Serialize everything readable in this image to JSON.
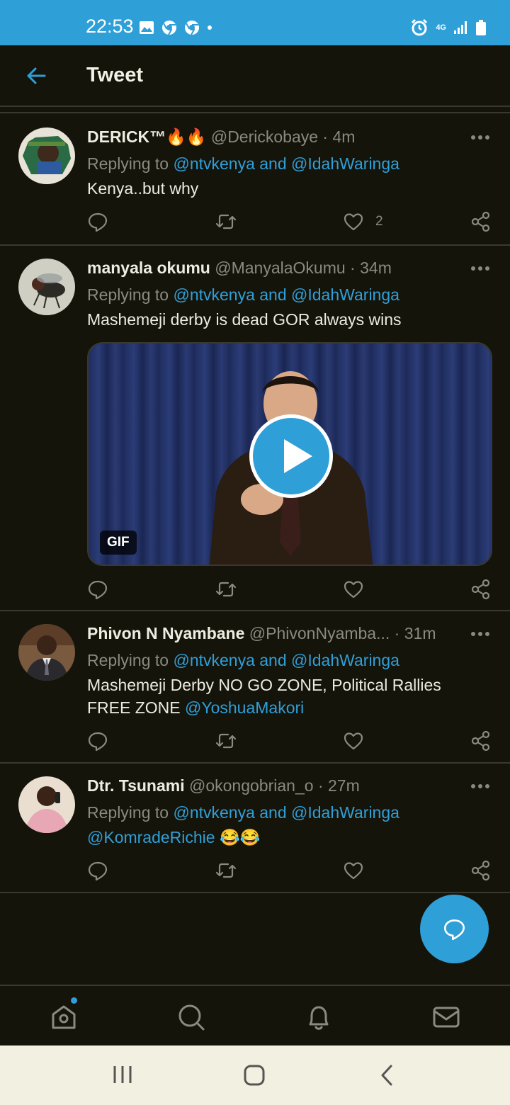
{
  "status": {
    "time": "22:53",
    "network": "4G"
  },
  "header": {
    "title": "Tweet"
  },
  "tweets": [
    {
      "name": "DERICK™🔥🔥",
      "handle": "@Derickobaye",
      "time": "4m",
      "replying_prefix": "Replying to",
      "replying_targets": "@ntvkenya and @IdahWaringa",
      "text": "Kenya..but why",
      "likes": "2"
    },
    {
      "name": "manyala okumu",
      "handle": "@ManyalaOkumu",
      "time": "34m",
      "replying_prefix": "Replying to",
      "replying_targets": "@ntvkenya and @IdahWaringa",
      "text": "Mashemeji derby is dead GOR always wins",
      "media_badge": "GIF"
    },
    {
      "name": "Phivon N Nyambane",
      "handle": "@PhivonNyamba...",
      "time": "31m",
      "replying_prefix": "Replying to",
      "replying_targets": "@ntvkenya and @IdahWaringa",
      "text_line1": "Mashemeji Derby NO GO ZONE, Political Rallies",
      "text_line2": "FREE ZONE",
      "text_mention": "@YoshuaMakori"
    },
    {
      "name": "Dtr. Tsunami",
      "handle": "@okongobrian_o",
      "time": "27m",
      "replying_prefix": "Replying to",
      "replying_targets": "@ntvkenya and @IdahWaringa",
      "text_mention": "@KomradeRichie",
      "text": "😂😂"
    }
  ],
  "colors": {
    "accent": "#2f9fd8",
    "background": "#15140a",
    "muted": "#8b8a80"
  },
  "icons": {
    "nav": [
      "home-icon",
      "search-icon",
      "notifications-icon",
      "messages-icon"
    ],
    "actions": [
      "reply-icon",
      "retweet-icon",
      "like-icon",
      "share-icon"
    ]
  }
}
